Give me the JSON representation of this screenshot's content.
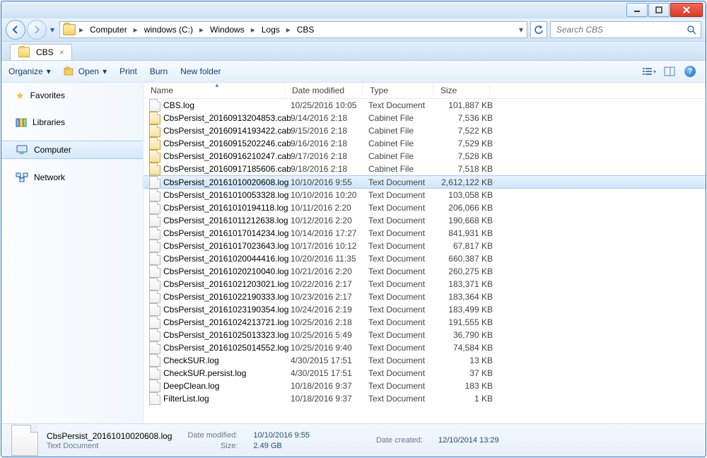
{
  "caption_buttons": {
    "minimize": "Minimize",
    "maximize": "Maximize",
    "close": "Close"
  },
  "breadcrumb": {
    "items": [
      "Computer",
      "windows (C:)",
      "Windows",
      "Logs",
      "CBS"
    ]
  },
  "search": {
    "placeholder": "Search CBS"
  },
  "tab": {
    "label": "CBS"
  },
  "toolbar": {
    "organize": "Organize",
    "open": "Open",
    "print": "Print",
    "burn": "Burn",
    "new_folder": "New folder"
  },
  "nav": {
    "favorites": "Favorites",
    "libraries": "Libraries",
    "computer": "Computer",
    "network": "Network"
  },
  "columns": {
    "name": "Name",
    "date": "Date modified",
    "type": "Type",
    "size": "Size"
  },
  "files": [
    {
      "name": "CBS.log",
      "date": "10/25/2016 10:05",
      "type": "Text Document",
      "size": "101,887 KB",
      "selected": false,
      "cab": false
    },
    {
      "name": "CbsPersist_20160913204853.cab",
      "date": "9/14/2016 2:18",
      "type": "Cabinet File",
      "size": "7,536 KB",
      "selected": false,
      "cab": true
    },
    {
      "name": "CbsPersist_20160914193422.cab",
      "date": "9/15/2016 2:18",
      "type": "Cabinet File",
      "size": "7,522 KB",
      "selected": false,
      "cab": true
    },
    {
      "name": "CbsPersist_20160915202246.cab",
      "date": "9/16/2016 2:18",
      "type": "Cabinet File",
      "size": "7,529 KB",
      "selected": false,
      "cab": true
    },
    {
      "name": "CbsPersist_20160916210247.cab",
      "date": "9/17/2016 2:18",
      "type": "Cabinet File",
      "size": "7,528 KB",
      "selected": false,
      "cab": true
    },
    {
      "name": "CbsPersist_20160917185606.cab",
      "date": "9/18/2016 2:18",
      "type": "Cabinet File",
      "size": "7,518 KB",
      "selected": false,
      "cab": true
    },
    {
      "name": "CbsPersist_20161010020608.log",
      "date": "10/10/2016 9:55",
      "type": "Text Document",
      "size": "2,612,122 KB",
      "selected": true,
      "cab": false
    },
    {
      "name": "CbsPersist_20161010053328.log",
      "date": "10/10/2016 10:20",
      "type": "Text Document",
      "size": "103,058 KB",
      "selected": false,
      "cab": false
    },
    {
      "name": "CbsPersist_20161010194118.log",
      "date": "10/11/2016 2:20",
      "type": "Text Document",
      "size": "206,066 KB",
      "selected": false,
      "cab": false
    },
    {
      "name": "CbsPersist_20161011212638.log",
      "date": "10/12/2016 2:20",
      "type": "Text Document",
      "size": "190,668 KB",
      "selected": false,
      "cab": false
    },
    {
      "name": "CbsPersist_20161017014234.log",
      "date": "10/14/2016 17:27",
      "type": "Text Document",
      "size": "841,931 KB",
      "selected": false,
      "cab": false
    },
    {
      "name": "CbsPersist_20161017023643.log",
      "date": "10/17/2016 10:12",
      "type": "Text Document",
      "size": "67,817 KB",
      "selected": false,
      "cab": false
    },
    {
      "name": "CbsPersist_20161020044416.log",
      "date": "10/20/2016 11:35",
      "type": "Text Document",
      "size": "660,387 KB",
      "selected": false,
      "cab": false
    },
    {
      "name": "CbsPersist_20161020210040.log",
      "date": "10/21/2016 2:20",
      "type": "Text Document",
      "size": "260,275 KB",
      "selected": false,
      "cab": false
    },
    {
      "name": "CbsPersist_20161021203021.log",
      "date": "10/22/2016 2:17",
      "type": "Text Document",
      "size": "183,371 KB",
      "selected": false,
      "cab": false
    },
    {
      "name": "CbsPersist_20161022190333.log",
      "date": "10/23/2016 2:17",
      "type": "Text Document",
      "size": "183,364 KB",
      "selected": false,
      "cab": false
    },
    {
      "name": "CbsPersist_20161023190354.log",
      "date": "10/24/2016 2:19",
      "type": "Text Document",
      "size": "183,499 KB",
      "selected": false,
      "cab": false
    },
    {
      "name": "CbsPersist_20161024213721.log",
      "date": "10/25/2016 2:18",
      "type": "Text Document",
      "size": "191,555 KB",
      "selected": false,
      "cab": false
    },
    {
      "name": "CbsPersist_20161025013323.log",
      "date": "10/25/2016 5:49",
      "type": "Text Document",
      "size": "36,790 KB",
      "selected": false,
      "cab": false
    },
    {
      "name": "CbsPersist_20161025014552.log",
      "date": "10/25/2016 9:40",
      "type": "Text Document",
      "size": "74,584 KB",
      "selected": false,
      "cab": false
    },
    {
      "name": "CheckSUR.log",
      "date": "4/30/2015 17:51",
      "type": "Text Document",
      "size": "13 KB",
      "selected": false,
      "cab": false
    },
    {
      "name": "CheckSUR.persist.log",
      "date": "4/30/2015 17:51",
      "type": "Text Document",
      "size": "37 KB",
      "selected": false,
      "cab": false
    },
    {
      "name": "DeepClean.log",
      "date": "10/18/2016 9:37",
      "type": "Text Document",
      "size": "183 KB",
      "selected": false,
      "cab": false
    },
    {
      "name": "FilterList.log",
      "date": "10/18/2016 9:37",
      "type": "Text Document",
      "size": "1 KB",
      "selected": false,
      "cab": false
    }
  ],
  "details": {
    "name": "CbsPersist_20161010020608.log",
    "type": "Text Document",
    "date_modified_label": "Date modified:",
    "date_modified": "10/10/2016 9:55",
    "size_label": "Size:",
    "size": "2.49 GB",
    "date_created_label": "Date created:",
    "date_created": "12/10/2014 13:29"
  }
}
